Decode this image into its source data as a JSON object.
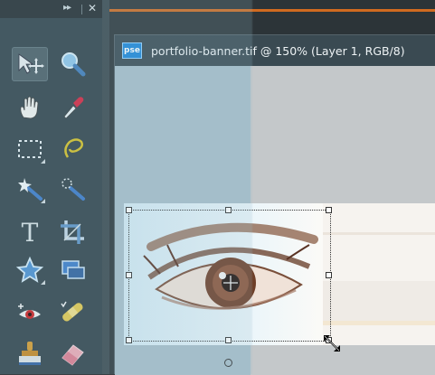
{
  "toolbox": {
    "collapse_label": "▸▸",
    "close_label": "✕",
    "tools": [
      {
        "name": "move-tool",
        "icon": "move-icon"
      },
      {
        "name": "zoom-tool",
        "icon": "magnifier-icon"
      },
      {
        "name": "hand-tool",
        "icon": "hand-icon"
      },
      {
        "name": "eyedropper-tool",
        "icon": "eyedropper-icon"
      },
      {
        "name": "marquee-tool",
        "icon": "rectangular-marquee-icon"
      },
      {
        "name": "lasso-tool",
        "icon": "lasso-icon"
      },
      {
        "name": "magic-wand-tool",
        "icon": "magic-wand-icon"
      },
      {
        "name": "quick-selection-tool",
        "icon": "quick-selection-icon"
      },
      {
        "name": "type-tool",
        "icon": "type-icon"
      },
      {
        "name": "crop-tool",
        "icon": "crop-icon"
      },
      {
        "name": "shape-tool",
        "icon": "star-shape-icon"
      },
      {
        "name": "cookie-cutter-tool",
        "icon": "layered-shape-icon"
      },
      {
        "name": "red-eye-tool",
        "icon": "red-eye-icon"
      },
      {
        "name": "healing-brush-tool",
        "icon": "bandage-icon"
      },
      {
        "name": "clone-stamp-tool",
        "icon": "stamp-icon"
      },
      {
        "name": "eraser-tool",
        "icon": "eraser-icon"
      }
    ],
    "type_glyph": "T"
  },
  "document": {
    "app_badge": "pse",
    "title": "portfolio-banner.tif @ 150% (Layer 1, RGB/8)"
  },
  "colors": {
    "accent": "#d06a20",
    "toolbox_bg": "#2f4047",
    "badge_bg": "#1b86d8"
  }
}
